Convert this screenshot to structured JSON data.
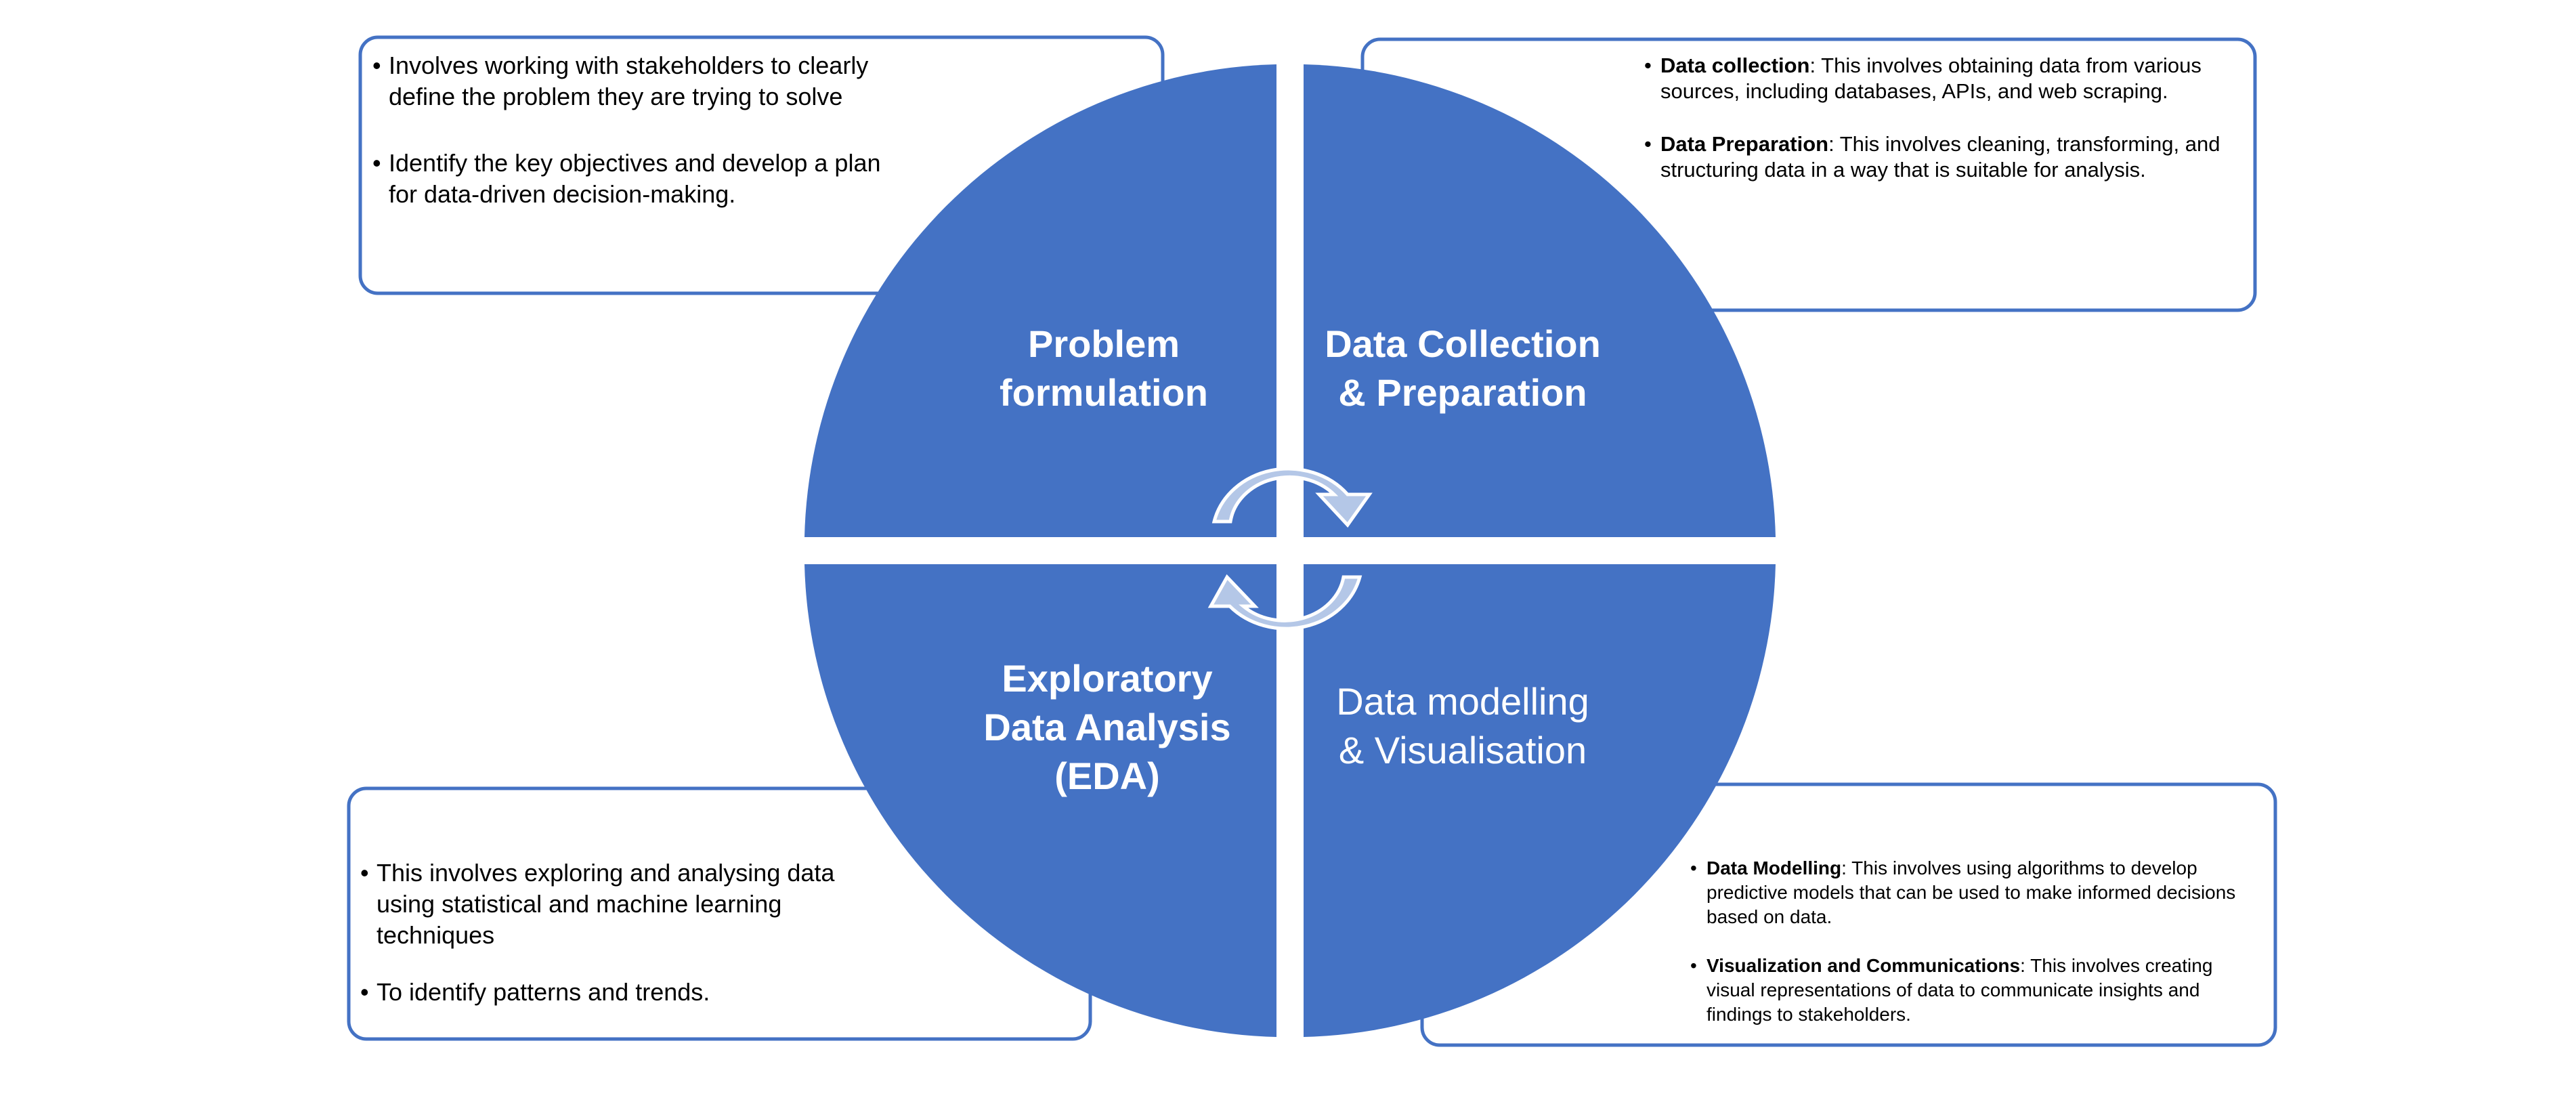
{
  "colors": {
    "quadrant_fill": "#4472C4",
    "box_stroke": "#4472C4",
    "arrow_fill": "#B4C7E7",
    "arrow_stroke": "#FFFFFF",
    "text": "#000000",
    "quadrant_text": "#FFFFFF"
  },
  "quadrants": {
    "top_left": {
      "label_line1": "Problem",
      "label_line2": "formulation"
    },
    "top_right": {
      "label_line1": "Data Collection",
      "label_line2": "& Preparation"
    },
    "bottom_left": {
      "label_line1": "Exploratory",
      "label_line2": "Data Analysis",
      "label_line3": "(EDA)"
    },
    "bottom_right": {
      "label_line1": "Data modelling",
      "label_line2": "& Visualisation"
    }
  },
  "callouts": {
    "top_left": {
      "bullet1": "Involves working with stakeholders to clearly define the problem they are trying to solve",
      "bullet2": "Identify the key objectives and develop a plan for data-driven decision-making."
    },
    "top_right": {
      "bullet1_term": "Data collection",
      "bullet1_text": ": This involves obtaining data from various sources, including databases, APIs, and web scraping.",
      "bullet2_term": "Data Preparation",
      "bullet2_text": ": This involves cleaning, transforming, and structuring data in a way that is suitable for analysis."
    },
    "bottom_left": {
      "bullet1": "This involves exploring and analysing data using statistical and machine learning techniques",
      "bullet2": "To identify patterns and trends."
    },
    "bottom_right": {
      "bullet1_term": "Data Modelling",
      "bullet1_text": ": This involves using algorithms to develop predictive models that can be used to make informed decisions based on data.",
      "bullet2_term": "Visualization and Communications",
      "bullet2_text": ": This involves creating visual representations of data to communicate insights and findings to stakeholders."
    }
  },
  "icons": {
    "top_arrow": "circular-arrow-clockwise-icon",
    "bottom_arrow": "circular-arrow-clockwise-icon"
  }
}
